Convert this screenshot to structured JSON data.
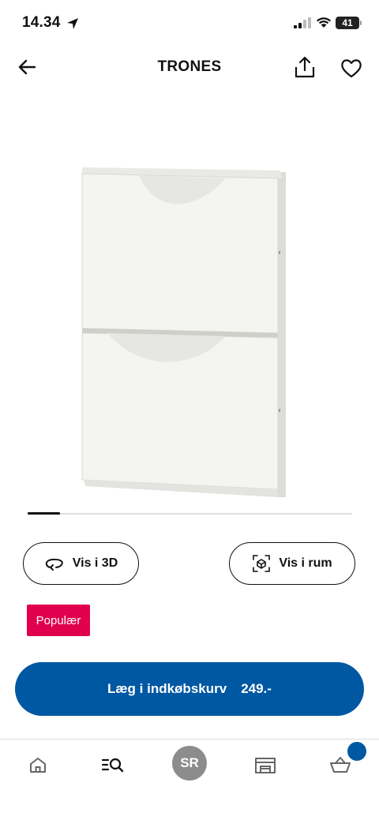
{
  "status_bar": {
    "time": "14.34",
    "battery": "41",
    "icons": [
      "location-arrow-icon",
      "signal-icon",
      "wifi-icon",
      "battery-icon"
    ]
  },
  "header": {
    "title": "TRONES",
    "icons": [
      "back-arrow-icon",
      "share-icon",
      "heart-icon"
    ]
  },
  "gallery": {
    "current_index": 1,
    "progress": 0.1
  },
  "actions": {
    "view_3d": "Vis i 3D",
    "view_room": "Vis i rum"
  },
  "badge": {
    "label": "Populær",
    "color": "#e0004d"
  },
  "cart": {
    "label": "Læg i indkøbskurv",
    "price": "249.-",
    "color": "#0058a3"
  },
  "bottom_nav": {
    "items": [
      "home-icon",
      "search-list-icon",
      "profile-avatar",
      "store-icon",
      "basket-icon"
    ],
    "profile_initials": "SR",
    "basket_indicator_color": "#0058a3"
  }
}
